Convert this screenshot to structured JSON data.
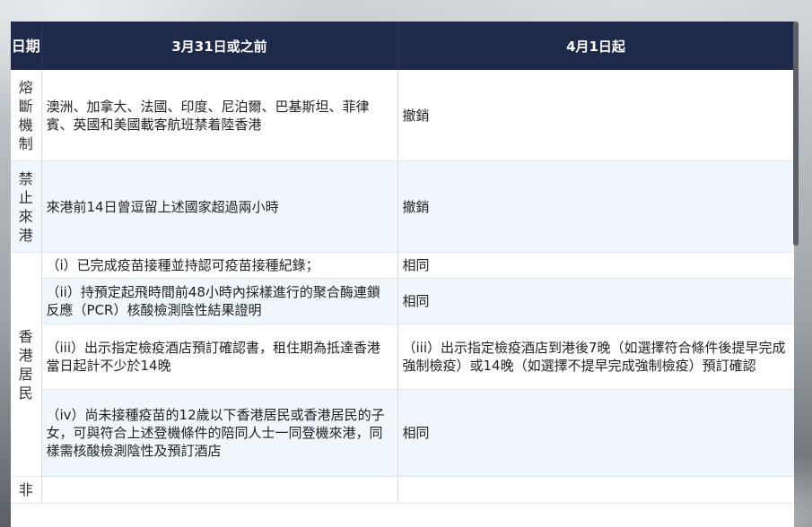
{
  "table": {
    "headers": {
      "date": "日期",
      "before": "3月31日或之前",
      "after": "4月1日起"
    },
    "rows": [
      {
        "category": "熔斷機制",
        "before": "澳洲、加拿大、法國、印度、尼泊爾、巴基斯坦、菲律賓、英國和美國載客航班禁着陸香港",
        "after": "撤銷"
      },
      {
        "category": "禁止來港",
        "before": "來港前14日曾逗留上述國家超過兩小時",
        "after": "撤銷"
      },
      {
        "before": "（i）已完成疫苗接種並持認可疫苗接種紀錄；",
        "after": "相同"
      },
      {
        "before": "（ii）持預定起飛時間前48小時內採樣進行的聚合酶連鎖反應（PCR）核酸檢測陰性結果證明",
        "after": "相同"
      },
      {
        "before": "（iii）出示指定檢疫酒店預訂確認書，租住期為抵達香港當日起計不少於14晚",
        "after": "（iii）出示指定檢疫酒店到港後7晚（如選擇符合條件後提早完成強制檢疫）或14晚（如選擇不提早完成強制檢疫）預訂確認"
      },
      {
        "before": "（iv）尚未接種疫苗的12歲以下香港居民或香港居民的子女，可與符合上述登機條件的陪同人士一同登機來港，同樣需核酸檢測陰性及預訂酒店",
        "after": "相同"
      }
    ],
    "residents_category": "香港居民",
    "partial_row_category": "非"
  }
}
